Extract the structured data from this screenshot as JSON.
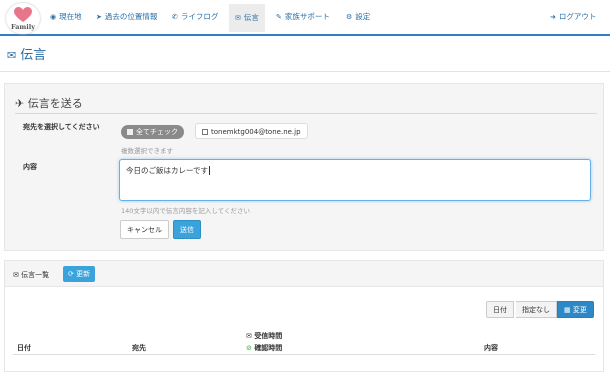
{
  "app": {
    "logo_text": "Family"
  },
  "nav": {
    "items": [
      {
        "icon": "location-icon",
        "glyph": "◉",
        "label": "現在地"
      },
      {
        "icon": "send-icon",
        "glyph": "➤",
        "label": "過去の位置情報"
      },
      {
        "icon": "phone-icon",
        "glyph": "✆",
        "label": "ライフログ"
      },
      {
        "icon": "envelope-icon",
        "glyph": "✉",
        "label": "伝言"
      },
      {
        "icon": "wrench-icon",
        "glyph": "✎",
        "label": "家族サポート"
      },
      {
        "icon": "gears-icon",
        "glyph": "⚙",
        "label": "設定"
      }
    ],
    "logout": {
      "icon": "logout-icon",
      "glyph": "➜",
      "label": "ログアウト"
    }
  },
  "page": {
    "title": "伝言"
  },
  "send_form": {
    "title": "伝言を送る",
    "recipient_label": "宛先を選択してください",
    "check_all_label": "全てチェック",
    "recipient_option": "tonemktg004@tone.ne.jp",
    "multi_hint": "複数選択できます",
    "content_label": "内容",
    "message_value": "今日のご飯はカレーです",
    "length_hint": "140文字以内で伝言内容を記入してください",
    "cancel_label": "キャンセル",
    "send_label": "送信"
  },
  "message_list": {
    "title": "伝言一覧",
    "refresh_label": "更新",
    "filter": {
      "date_label": "日付",
      "none_label": "指定なし",
      "change_label": "変更"
    },
    "columns": {
      "date": "日付",
      "recipient": "宛先",
      "received_time": "受信時間",
      "confirmed_time": "確認時間",
      "content": "内容"
    }
  },
  "colors": {
    "accent": "#2f7fc1",
    "button_primary": "#3ba3dc",
    "link": "#2a6fa8",
    "heart": "#e8768a"
  }
}
